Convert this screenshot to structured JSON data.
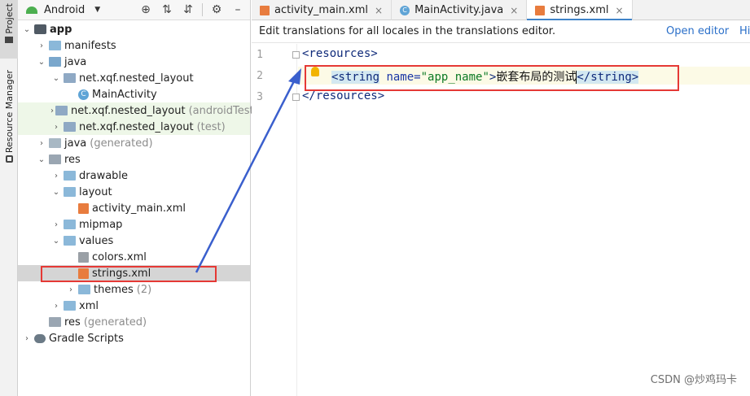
{
  "side_strip": {
    "project_label": "Project",
    "resource_manager_label": "Resource Manager"
  },
  "project_panel": {
    "view_selector": "Android",
    "tree": [
      {
        "label": "app",
        "hint": ""
      },
      {
        "label": "manifests",
        "hint": ""
      },
      {
        "label": "java",
        "hint": ""
      },
      {
        "label": "net.xqf.nested_layout",
        "hint": ""
      },
      {
        "label": "MainActivity",
        "hint": ""
      },
      {
        "label": "net.xqf.nested_layout",
        "hint": "(androidTest)"
      },
      {
        "label": "net.xqf.nested_layout",
        "hint": "(test)"
      },
      {
        "label": "java",
        "hint": "(generated)"
      },
      {
        "label": "res",
        "hint": ""
      },
      {
        "label": "drawable",
        "hint": ""
      },
      {
        "label": "layout",
        "hint": ""
      },
      {
        "label": "activity_main.xml",
        "hint": ""
      },
      {
        "label": "mipmap",
        "hint": ""
      },
      {
        "label": "values",
        "hint": ""
      },
      {
        "label": "colors.xml",
        "hint": ""
      },
      {
        "label": "strings.xml",
        "hint": ""
      },
      {
        "label": "themes",
        "hint": "(2)"
      },
      {
        "label": "xml",
        "hint": ""
      },
      {
        "label": "res",
        "hint": "(generated)"
      },
      {
        "label": "Gradle Scripts",
        "hint": ""
      }
    ]
  },
  "editor": {
    "tabs": [
      {
        "label": "activity_main.xml",
        "icon": "xml-file-icon"
      },
      {
        "label": "MainActivity.java",
        "icon": "class-icon"
      },
      {
        "label": "strings.xml",
        "icon": "xml-file-icon"
      }
    ],
    "banner": {
      "message": "Edit translations for all locales in the translations editor.",
      "open_editor": "Open editor",
      "hide": "Hi"
    },
    "line_numbers": [
      "1",
      "2",
      "3"
    ],
    "code": {
      "line1": "<resources>",
      "line2_open": "<string",
      "line2_attr": "name=",
      "line2_value": "\"app_name\"",
      "line2_gt": ">",
      "line2_text": "嵌套布局的测试",
      "line2_close": "</string>",
      "line3": "</resources>"
    }
  },
  "watermark": "CSDN @炒鸡玛卡",
  "colors": {
    "highlight_box": "#e53935",
    "annotation_arrow": "#3a5fcd",
    "accent_tab": "#4083c9",
    "selected_row": "#d5d5d5"
  }
}
